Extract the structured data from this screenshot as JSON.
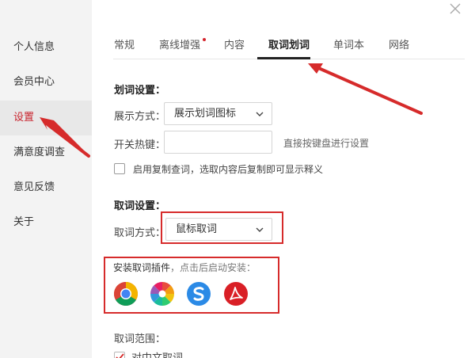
{
  "sidebar": {
    "items": [
      {
        "label": "个人信息"
      },
      {
        "label": "会员中心"
      },
      {
        "label": "设置"
      },
      {
        "label": "满意度调查"
      },
      {
        "label": "意见反馈"
      },
      {
        "label": "关于"
      }
    ]
  },
  "close_label": "×",
  "tabs": [
    {
      "label": "常规"
    },
    {
      "label": "离线增强"
    },
    {
      "label": "内容"
    },
    {
      "label": "取词划词"
    },
    {
      "label": "单词本"
    },
    {
      "label": "网络"
    }
  ],
  "huaci": {
    "title": "划词设置：",
    "display_label": "展示方式：",
    "display_value": "展示划词图标",
    "hotkey_label": "开关热键：",
    "hotkey_value": "",
    "hotkey_hint": "直接按键盘进行设置",
    "copy_checkbox_label": "启用复制查词，选取内容后复制即可显示释义",
    "copy_checked": false
  },
  "quci": {
    "title": "取词设置：",
    "mode_label": "取词方式：",
    "mode_value": "鼠标取词"
  },
  "plugins": {
    "title": "安装取词插件",
    "subtitle": "，点击后启动安装：",
    "items": [
      {
        "icon": "chrome-icon"
      },
      {
        "icon": "pinwheel-icon"
      },
      {
        "icon": "sogou-browser-icon"
      },
      {
        "icon": "pdf-icon"
      }
    ]
  },
  "range": {
    "title": "取词范围：",
    "option_label": "对中文取词",
    "option_checked": true
  },
  "colors": {
    "accent": "#d62b2b",
    "active_text": "#c8222c"
  }
}
